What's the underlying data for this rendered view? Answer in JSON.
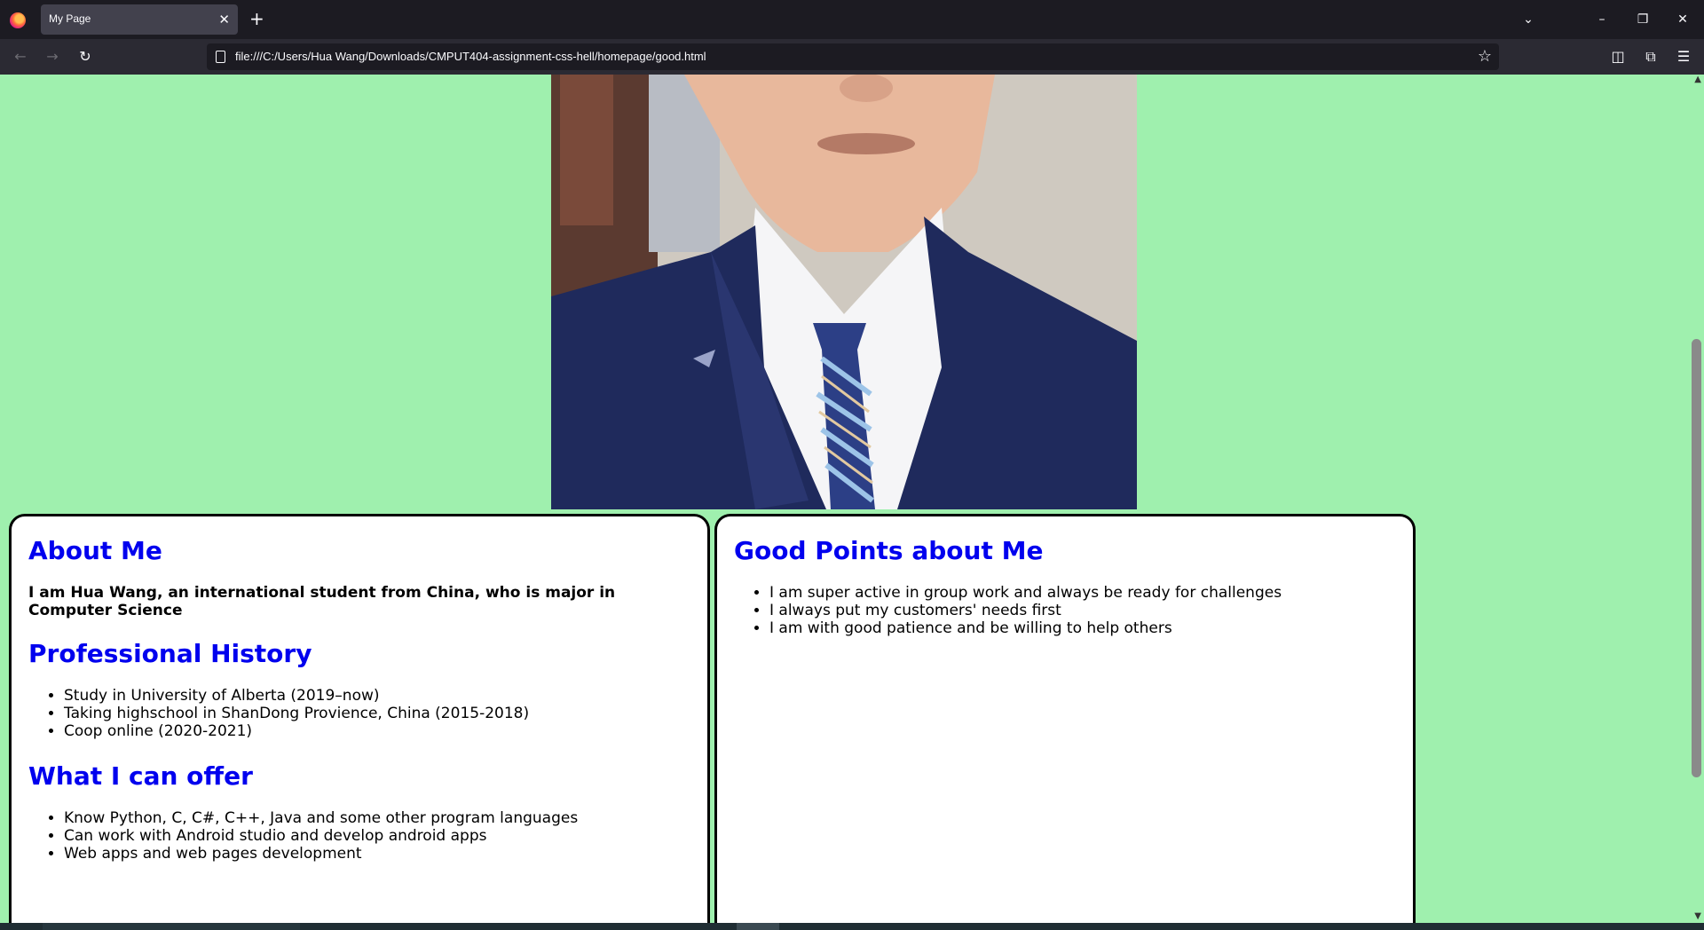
{
  "browser": {
    "tab_title": "My Page",
    "tab_close": "✕",
    "new_tab": "+",
    "url": "file:///C:/Users/Hua Wang/Downloads/CMPUT404-assignment-css-hell/homepage/good.html",
    "icons": [
      "firefox-logo",
      "close-icon",
      "plus-icon",
      "chevron-down-icon",
      "minimize-icon",
      "restore-icon",
      "close-window-icon",
      "back-arrow-icon",
      "forward-arrow-icon",
      "reload-icon",
      "page-icon",
      "star-icon",
      "pocket-icon",
      "extensions-icon",
      "menu-icon"
    ]
  },
  "window_controls": {
    "list_tabs": "⌄",
    "minimize": "–",
    "restore": "❐",
    "close": "✕"
  },
  "nav": {
    "back": "←",
    "forward": "→",
    "reload": "↻",
    "star": "☆",
    "pocket": "◫",
    "extensions": "⧉",
    "menu": "☰"
  },
  "page": {
    "background_color": "#9ff0ae",
    "heading_color": "#0000ee",
    "about": {
      "heading": "About Me",
      "intro": "I am Hua Wang, an international student from China, who is major in Computer Science"
    },
    "history": {
      "heading": "Professional History",
      "items": [
        "Study in University of Alberta (2019–now)",
        "Taking highschool in ShanDong Provience, China (2015-2018)",
        "Coop online (2020-2021)"
      ]
    },
    "offer": {
      "heading": "What I can offer",
      "items": [
        "Know Python, C, C#, C++, Java and some other program languages",
        "Can work with Android studio and develop android apps",
        "Web apps and web pages development"
      ]
    },
    "good_points": {
      "heading": "Good Points about Me",
      "items": [
        "I am super active in group work and always be ready for challenges",
        "I always put my customers' needs first",
        "I am with good patience and be willing to help others"
      ]
    }
  }
}
